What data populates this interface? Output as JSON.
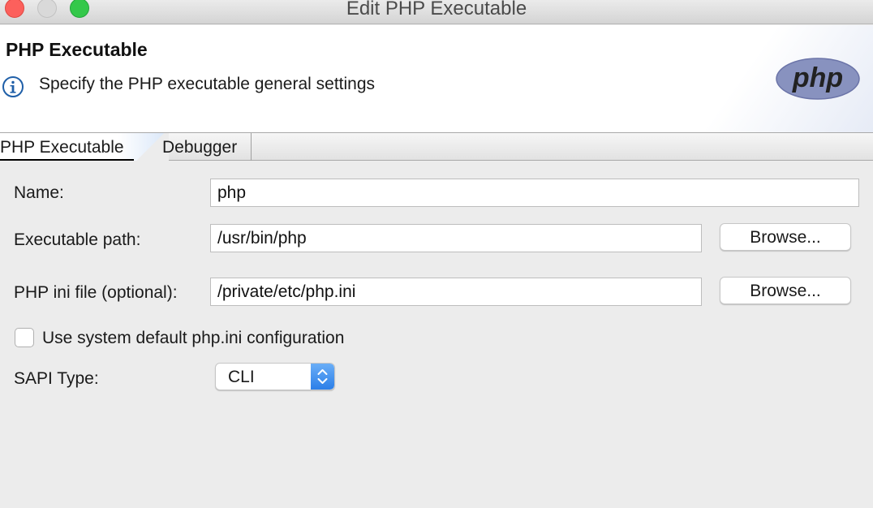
{
  "window": {
    "title": "Edit PHP Executable"
  },
  "header": {
    "title": "PHP Executable",
    "description": "Specify the PHP executable general settings",
    "logo_text": "php"
  },
  "tabs": [
    {
      "label": "PHP Executable",
      "active": true
    },
    {
      "label": "Debugger",
      "active": false
    }
  ],
  "form": {
    "name": {
      "label": "Name:",
      "value": "php"
    },
    "executable_path": {
      "label": "Executable path:",
      "value": "/usr/bin/php",
      "button": "Browse..."
    },
    "ini_file": {
      "label": "PHP ini file (optional):",
      "value": "/private/etc/php.ini",
      "button": "Browse..."
    },
    "use_default_ini": {
      "label": "Use system default php.ini configuration",
      "checked": false
    },
    "sapi_type": {
      "label": "SAPI Type:",
      "value": "CLI"
    }
  },
  "colors": {
    "close": "#fc605c",
    "minimize": "#d9d9d9",
    "maximize": "#34c84a",
    "accent": "#2c7fe8",
    "php_logo": "#8892bf"
  },
  "icons": {
    "info": "info-icon",
    "select_arrows": "chevron-up-down-icon"
  }
}
